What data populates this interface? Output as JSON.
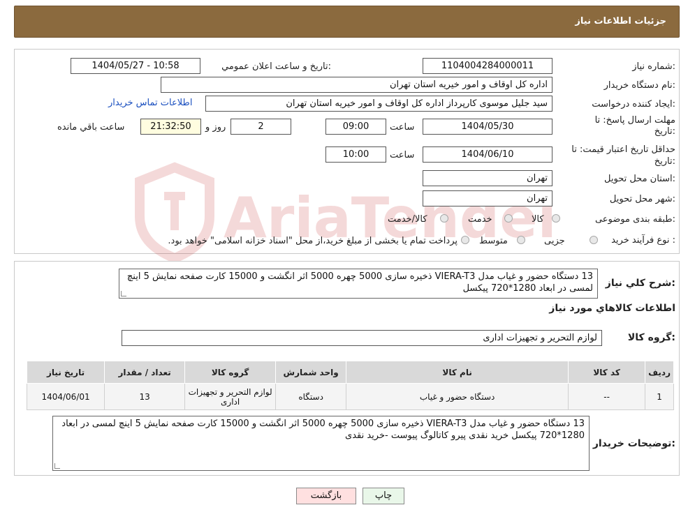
{
  "header": {
    "title": "جزئیات اطلاعات نیاز"
  },
  "form": {
    "need_number_label": "شماره نیاز:",
    "need_number": "1104004284000011",
    "announce_label": "تاریخ و ساعت اعلان عمومي:",
    "announce_value": "1404/05/27 - 10:58",
    "buyer_org_label": "نام دستگاه خريدار:",
    "buyer_org": "اداره کل اوقاف و امور خیریه استان تهران",
    "creator_label": "ایجاد کننده درخواست:",
    "creator": "سید جلیل موسوی کارپرداز اداره کل اوقاف و امور خیریه استان تهران",
    "contact_link": "اطلاعات تماس خريدار",
    "deadline_label_1": "مهلت ارسال پاسخ: تا",
    "deadline_label_2": "تاریخ:",
    "deadline_date": "1404/05/30",
    "time_label": "ساعت",
    "deadline_time": "09:00",
    "days_value": "2",
    "days_label": "روز و",
    "remaining_time": "21:32:50",
    "remaining_label": "ساعت باقي مانده",
    "validity_label_1": "حداقل تاریخ اعتبار قیمت: تا",
    "validity_label_2": "تاریخ:",
    "validity_date": "1404/06/10",
    "validity_time": "10:00",
    "province_label": "استان محل تحویل:",
    "province": "تهران",
    "city_label": "شهر محل تحویل:",
    "city": "تهران",
    "category_label": "طبقه بندی موضوعی:",
    "category_options": [
      "کالا",
      "خدمت",
      "کالا/خدمت"
    ],
    "process_label": "نوع فرآیند خرید :",
    "process_options": [
      "جزیی",
      "متوسط"
    ],
    "process_note": "پرداخت تمام یا بخشی از مبلغ خرید،از محل \"اسناد خزانه اسلامی\" خواهد بود."
  },
  "details": {
    "summary_label": "شرح کلي نياز:",
    "summary_text": "13 دستگاه حضور و غیاب مدل VIERA-T3 ذخیره سازی 5000 چهره 5000 اثر انگشت و 15000 کارت صفحه نمایش 5 اینچ لمسی در ابعاد 1280*720 پیکسل",
    "goods_info_title": "اطلاعات کالاهاي مورد نياز",
    "goods_group_label": "گروه کالا:",
    "goods_group": "لوازم التحریر و تجهیزات اداری",
    "table": {
      "headers": [
        "رديف",
        "کد کالا",
        "نام کالا",
        "واحد شمارش",
        "گروه کالا",
        "تعداد / مقدار",
        "تاريخ نياز"
      ],
      "rows": [
        [
          "1",
          "--",
          "دستگاه حضور و غیاب",
          "دستگاه",
          "لوازم التحریر و تجهیزات اداری",
          "13",
          "1404/06/01"
        ]
      ]
    },
    "buyer_notes_label": "توضيحات خريدار:",
    "buyer_notes": "13 دستگاه حضور و غیاب مدل VIERA-T3 ذخیره سازی 5000 چهره 5000 اثر انگشت و 15000 کارت صفحه نمایش 5 اینچ لمسی در ابعاد 1280*720 پیکسل   خرید نقدی پیرو کاتالوگ پیوست -خرید نقدی"
  },
  "buttons": {
    "print": "چاپ",
    "back": "بازگشت"
  },
  "watermark": {
    "text": "AriaTender.neT"
  },
  "colors": {
    "header": "#8b6a3e",
    "link": "#1a4fbf",
    "back_button": "#ffe0e0",
    "print_button": "#e9f7e9"
  }
}
